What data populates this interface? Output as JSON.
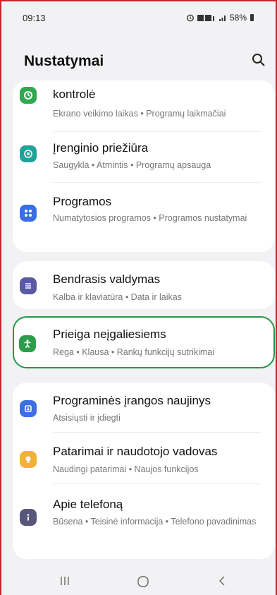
{
  "status": {
    "time": "09:13",
    "battery": "58%"
  },
  "header": {
    "title": "Nustatymai"
  },
  "items": [
    {
      "title": "kontrolė",
      "subtitle": "Ekrano veikimo laikas • Programų laikmačiai",
      "color": "#2fa84f"
    },
    {
      "title": "Įrenginio priežiūra",
      "subtitle": "Saugykla • Atmintis • Programų apsauga",
      "color": "#1ea39a"
    },
    {
      "title": "Programos",
      "subtitle": "Numatytosios programos • Programos nustatymai",
      "color": "#3b6fe0"
    },
    {
      "title": "Bendrasis valdymas",
      "subtitle": "Kalba ir klaviatūra • Data ir laikas",
      "color": "#5a5aa3"
    },
    {
      "title": "Prieiga neįgaliesiems",
      "subtitle": "Rega • Klausa • Rankų funkcijų sutrikimai",
      "color": "#2c9d4c"
    },
    {
      "title": "Programinės įrangos naujinys",
      "subtitle": "Atsisiųsti ir įdiegti",
      "color": "#3d6fe2"
    },
    {
      "title": "Patarimai ir naudotojo vadovas",
      "subtitle": "Naudingi patarimai • Naujos funkcijos",
      "color": "#f2b23a"
    },
    {
      "title": "Apie telefoną",
      "subtitle": "Būsena • Teisinė informacija • Telefono pavadinimas",
      "color": "#58567a"
    }
  ],
  "nav": {
    "recents": "|||",
    "home": "○",
    "back": "‹"
  }
}
